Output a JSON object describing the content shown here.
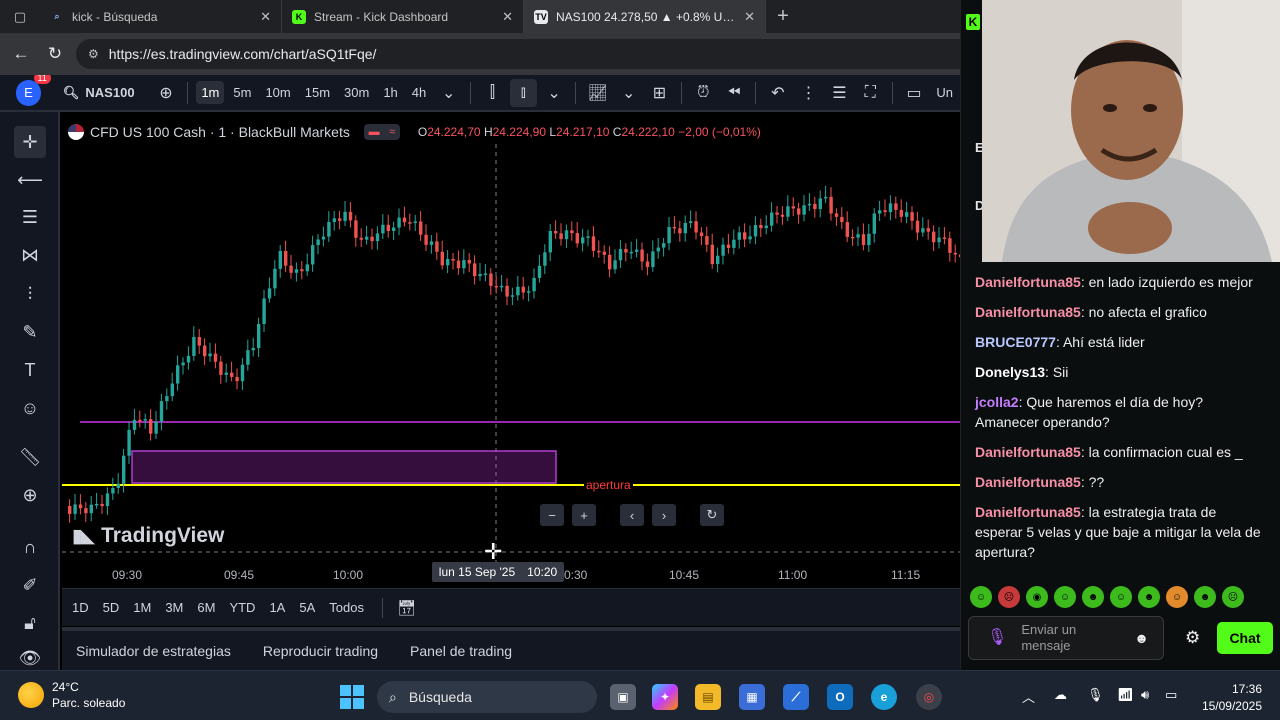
{
  "browser": {
    "tabs": [
      {
        "title": "kick - Búsqueda",
        "active": false
      },
      {
        "title": "Stream - Kick Dashboard",
        "active": false
      },
      {
        "title": "NAS100 24.278,50 ▲ +0.8% Unnam",
        "active": true
      }
    ],
    "url": "https://es.tradingview.com/chart/aSQ1tFqe/"
  },
  "tv_toolbar": {
    "avatar_letter": "E",
    "notifications": "11",
    "symbol": "NAS100",
    "intervals": [
      "1m",
      "5m",
      "10m",
      "15m",
      "30m",
      "1h",
      "4h"
    ],
    "selected_interval": "1m",
    "cutoff_label": "Un"
  },
  "chart": {
    "instrument": "CFD US 100 Cash · 1 · BlackBull Markets",
    "ohlc": {
      "o": "24.224,70",
      "h": "24.224,90",
      "l": "24.217,10",
      "c": "24.222,10",
      "change": "−2,00 (−0,01%)"
    },
    "annotation": "apertura",
    "watermark": "TradingView",
    "crosshair_time": {
      "date": "lun 15 Sep '25",
      "time": "10:20"
    },
    "time_ticks": [
      "09:30",
      "09:45",
      "10:00",
      "0:30",
      "10:45",
      "11:00",
      "11:15"
    ],
    "colors": {
      "up": "#26a69a",
      "down": "#ef5350",
      "level_line": "#9c27b0",
      "apertura_line": "#ffff00",
      "zone": "#9c27b0"
    }
  },
  "range_bar": [
    "1D",
    "5D",
    "1M",
    "3M",
    "6M",
    "YTD",
    "1A",
    "5A",
    "Todos"
  ],
  "bottom_tabs": [
    "Simulador de estrategias",
    "Reproducir trading",
    "Panel de trading"
  ],
  "kick_chat": {
    "messages": [
      {
        "user": "Danielfortuna85",
        "color": "#f78fa7",
        "text": "en lado izquierdo es mejor"
      },
      {
        "user": "Danielfortuna85",
        "color": "#f78fa7",
        "text": "no afecta el grafico"
      },
      {
        "user": "BRUCE0777",
        "color": "#b8c8ff",
        "text": "Ahí está lider"
      },
      {
        "user": "Donelys13",
        "color": "#ffffff",
        "text": "Sii"
      },
      {
        "user": "jcolla2",
        "color": "#c47dff",
        "text": "Que haremos el día de hoy? Amanecer operando?"
      },
      {
        "user": "Danielfortuna85",
        "color": "#f78fa7",
        "text": "la confirmacion cual es _"
      },
      {
        "user": "Danielfortuna85",
        "color": "#f78fa7",
        "text": "??"
      },
      {
        "user": "Danielfortuna85",
        "color": "#f78fa7",
        "text": "la estrategia trata de esperar 5 velas y que baje a mitigar la vela de apertura?"
      }
    ],
    "input_placeholder": "Enviar un mensaje",
    "send_label": "Chat"
  },
  "taskbar": {
    "weather_temp": "24°C",
    "weather_desc": "Parc. soleado",
    "search_label": "Búsqueda",
    "time": "17:36",
    "date": "15/09/2025"
  }
}
